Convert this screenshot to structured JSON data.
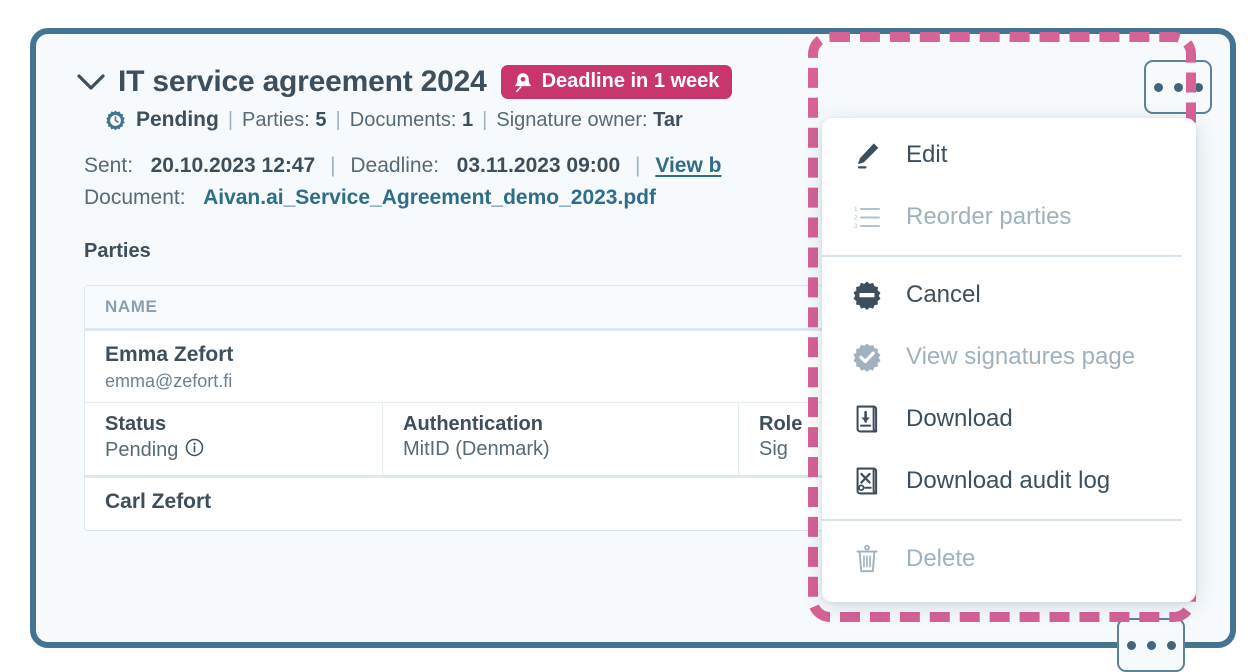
{
  "card": {
    "title": "IT service agreement 2024",
    "chevron_icon": "chevron-down-icon",
    "deadline_badge": {
      "icon": "bell-icon",
      "label": "Deadline in 1 week"
    },
    "meta": {
      "status_icon": "gear-clock-icon",
      "status": "Pending",
      "parties_label": "Parties:",
      "parties_count": "5",
      "documents_label": "Documents:",
      "documents_count": "1",
      "owner_label": "Signature owner:",
      "owner_value": "Tar"
    },
    "info": {
      "sent_label": "Sent:",
      "sent_value": "20.10.2023 12:47",
      "deadline_label": "Deadline:",
      "deadline_value": "03.11.2023 09:00",
      "view_link": "View b",
      "document_label": "Document:",
      "document_value": "Aivan.ai_Service_Agreement_demo_2023.pdf"
    },
    "parties_heading": "Parties",
    "table": {
      "columns": [
        "NAME"
      ],
      "rows": [
        {
          "name": "Emma Zefort",
          "email": "emma@zefort.fi",
          "details": [
            {
              "label": "Status",
              "value": "Pending",
              "info_icon": "info-circle-icon"
            },
            {
              "label": "Authentication",
              "value": "MitID (Denmark)"
            },
            {
              "label": "Role",
              "value": "Sig"
            }
          ]
        },
        {
          "name": "Carl Zefort"
        }
      ]
    },
    "kebab_button": {
      "name": "more-options-button",
      "dots": 3
    },
    "kebab_button_bottom": {
      "name": "more-options-button-secondary",
      "dots": 3
    }
  },
  "menu": {
    "groups": [
      {
        "items": [
          {
            "icon": "pencil-icon",
            "label": "Edit",
            "disabled": false
          },
          {
            "icon": "reorder-list-icon",
            "label": "Reorder parties",
            "disabled": true
          }
        ]
      },
      {
        "items": [
          {
            "icon": "gear-cancel-icon",
            "label": "Cancel",
            "disabled": false
          },
          {
            "icon": "gear-check-icon",
            "label": "View signatures page",
            "disabled": true
          },
          {
            "icon": "download-document-icon",
            "label": "Download",
            "disabled": false
          },
          {
            "icon": "download-audit-log-icon",
            "label": "Download audit log",
            "disabled": false
          }
        ]
      },
      {
        "items": [
          {
            "icon": "trash-icon",
            "label": "Delete",
            "disabled": true
          }
        ]
      }
    ]
  },
  "colors": {
    "card_border": "#457491",
    "card_background": "#f6fafc",
    "accent_pink": "#c8366d",
    "highlight_pink": "#d66296",
    "link_blue": "#2f6e88",
    "text_dark": "#3d4f5c",
    "text_muted": "#6d8190"
  }
}
